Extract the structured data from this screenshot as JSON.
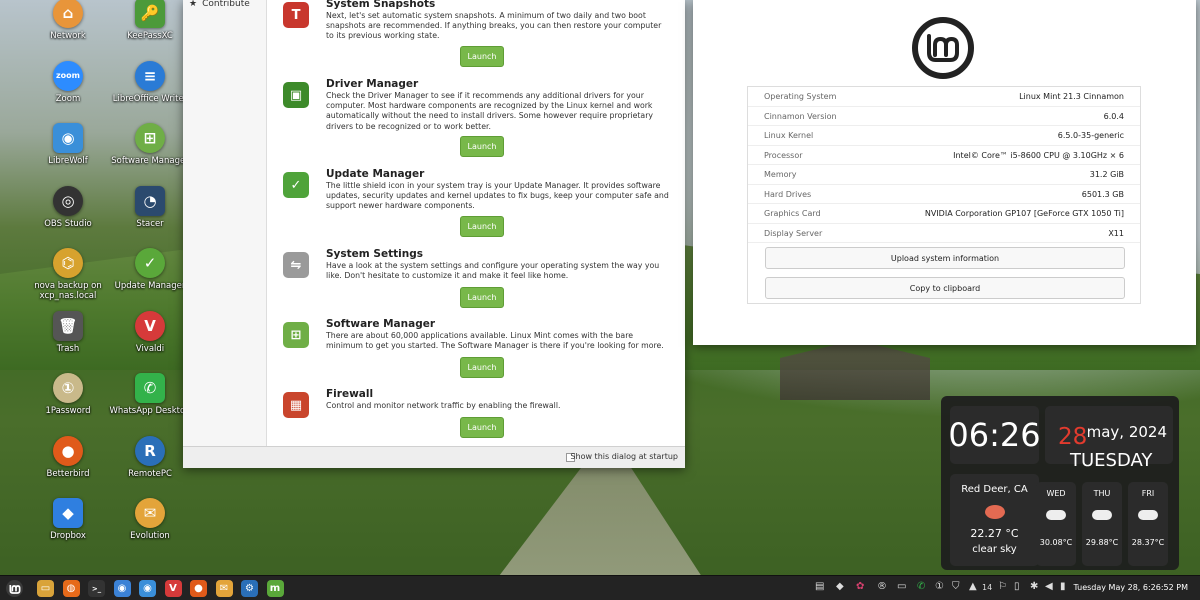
{
  "desktop_icons": [
    {
      "label": "Network",
      "glyph": "⌂",
      "color": "#e8953a",
      "icon": "network-icon"
    },
    {
      "label": "KeePassXC",
      "glyph": "🔑",
      "color": "#4c9a3a",
      "icon": "keepassxc-icon"
    },
    {
      "label": "Zoom",
      "glyph": "zoom",
      "color": "#2d8cff",
      "icon": "zoom-icon"
    },
    {
      "label": "LibreOffice Writer",
      "glyph": "≡",
      "color": "#2a7bd6",
      "icon": "libreoffice-writer-icon"
    },
    {
      "label": "LibreWolf",
      "glyph": "◉",
      "color": "#3a8fd9",
      "icon": "librewolf-icon"
    },
    {
      "label": "Software Manager",
      "glyph": "⊞",
      "color": "#6fae46",
      "icon": "software-manager-icon"
    },
    {
      "label": "OBS Studio",
      "glyph": "◎",
      "color": "#333333",
      "icon": "obs-studio-icon"
    },
    {
      "label": "Stacer",
      "glyph": "◔",
      "color": "#2b4a6e",
      "icon": "stacer-icon"
    },
    {
      "label": "nova backup on xcp_nas.local",
      "glyph": "⌬",
      "color": "#d7a22e",
      "icon": "network-share-icon"
    },
    {
      "label": "Update Manager",
      "glyph": "✓",
      "color": "#5aa83a",
      "icon": "update-manager-icon"
    },
    {
      "label": "Trash",
      "glyph": "🗑",
      "color": "#555555",
      "icon": "trash-icon"
    },
    {
      "label": "Vivaldi",
      "glyph": "V",
      "color": "#d63a3a",
      "icon": "vivaldi-icon"
    },
    {
      "label": "1Password",
      "glyph": "①",
      "color": "#c9b98a",
      "icon": "onepassword-icon"
    },
    {
      "label": "WhatsApp Desktop",
      "glyph": "✆",
      "color": "#33b24a",
      "icon": "whatsapp-icon"
    },
    {
      "label": "Betterbird",
      "glyph": "●",
      "color": "#e05a1a",
      "icon": "betterbird-icon"
    },
    {
      "label": "RemotePC",
      "glyph": "R",
      "color": "#2a6fb8",
      "icon": "remotepc-icon"
    },
    {
      "label": "Dropbox",
      "glyph": "◆",
      "color": "#2f7fe0",
      "icon": "dropbox-icon"
    },
    {
      "label": "Evolution",
      "glyph": "✉",
      "color": "#e3a43a",
      "icon": "evolution-icon"
    }
  ],
  "welcome": {
    "sidebar_item": "Contribute",
    "launch_label": "Launch",
    "show_at_startup": "Show this dialog at startup",
    "sections": [
      {
        "title": "System Snapshots",
        "icon": "timeshift-icon",
        "glyph": "T",
        "color": "#c8372d",
        "desc": "Next, let's set automatic system snapshots. A minimum of two daily and two boot snapshots are recommended. If anything breaks, you can then restore your computer to its previous working state."
      },
      {
        "title": "Driver Manager",
        "icon": "driver-manager-icon",
        "glyph": "▣",
        "color": "#3d8a2a",
        "desc": "Check the Driver Manager to see if it recommends any additional drivers for your computer. Most hardware components are recognized by the Linux kernel and work automatically without the need to install drivers. Some however require proprietary drivers to be recognized or to work better."
      },
      {
        "title": "Update Manager",
        "icon": "shield-icon",
        "glyph": "✓",
        "color": "#4fa33a",
        "desc": "The little shield icon in your system tray is your Update Manager. It provides software updates, security updates and kernel updates to fix bugs, keep your computer safe and support newer hardware components."
      },
      {
        "title": "System Settings",
        "icon": "toggle-settings-icon",
        "glyph": "⇋",
        "color": "#9a9a9a",
        "desc": "Have a look at the system settings and configure your operating system the way you like. Don't hesitate to customize it and make it feel like home."
      },
      {
        "title": "Software Manager",
        "icon": "software-manager-icon",
        "glyph": "⊞",
        "color": "#6fae46",
        "desc": "There are about 60,000 applications available. Linux Mint comes with the bare minimum to get you started. The Software Manager is there if you're looking for more."
      },
      {
        "title": "Firewall",
        "icon": "firewall-icon",
        "glyph": "▦",
        "color": "#c9452c",
        "desc": "Control and monitor network traffic by enabling the firewall."
      }
    ]
  },
  "sysinfo": {
    "rows": [
      {
        "key": "Operating System",
        "value": "Linux Mint 21.3 Cinnamon"
      },
      {
        "key": "Cinnamon Version",
        "value": "6.0.4"
      },
      {
        "key": "Linux Kernel",
        "value": "6.5.0-35-generic"
      },
      {
        "key": "Processor",
        "value": "Intel© Core™ i5-8600 CPU @ 3.10GHz × 6"
      },
      {
        "key": "Memory",
        "value": "31.2 GiB"
      },
      {
        "key": "Hard Drives",
        "value": "6501.3 GB"
      },
      {
        "key": "Graphics Card",
        "value": "NVIDIA Corporation GP107 [GeForce GTX 1050 Ti]"
      },
      {
        "key": "Display Server",
        "value": "X11"
      }
    ],
    "upload_label": "Upload system information",
    "copy_label": "Copy to clipboard"
  },
  "widget": {
    "time": "06:26",
    "day": "28",
    "month_year": "may, 2024",
    "weekday": "TUESDAY",
    "city": "Red Deer, CA",
    "temp": "22.27 °C",
    "condition": "clear sky",
    "forecast": [
      {
        "day": "WED",
        "temp": "30.08°C"
      },
      {
        "day": "THU",
        "temp": "29.88°C"
      },
      {
        "day": "FRI",
        "temp": "28.37°C"
      }
    ]
  },
  "taskbar": {
    "clock": "Tuesday May 28, 6:26:52 PM",
    "tray_number": "14",
    "apps": [
      {
        "icon": "files-icon",
        "glyph": "▭",
        "color": "#d9a33a"
      },
      {
        "icon": "firefox-icon",
        "glyph": "◍",
        "color": "#e66a1a"
      },
      {
        "icon": "terminal-icon",
        "glyph": ">_",
        "color": "#333333"
      },
      {
        "icon": "chrome-icon",
        "glyph": "◉",
        "color": "#3b82d6"
      },
      {
        "icon": "librewolf-icon",
        "glyph": "◉",
        "color": "#3a8fd9"
      },
      {
        "icon": "vivaldi-icon",
        "glyph": "V",
        "color": "#d63a3a"
      },
      {
        "icon": "betterbird-icon",
        "glyph": "●",
        "color": "#e05a1a"
      },
      {
        "icon": "evolution-icon",
        "glyph": "✉",
        "color": "#e3a43a"
      },
      {
        "icon": "settings-icon",
        "glyph": "⚙",
        "color": "#2a6fb8"
      },
      {
        "icon": "mint-update-icon",
        "glyph": "m",
        "color": "#5aa83a"
      }
    ]
  }
}
